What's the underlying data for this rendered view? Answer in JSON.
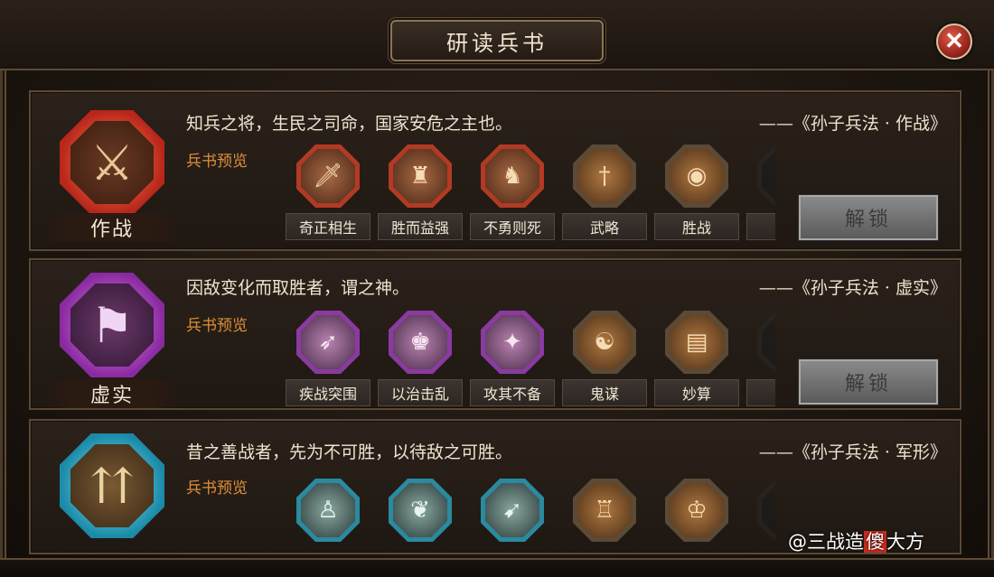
{
  "window": {
    "title": "研读兵书",
    "close_glyph": "✕"
  },
  "books": [
    {
      "name": "作战",
      "quote": "知兵之将，生民之司命，国家安危之主也。",
      "source": "——《孙子兵法 · 作战》",
      "preview_label": "兵书预览",
      "emblem_icon": "crossed-swords-icon",
      "skills": [
        {
          "name": "奇正相生",
          "icon": "sword-strike-icon"
        },
        {
          "name": "胜而益强",
          "icon": "warrior-icon"
        },
        {
          "name": "不勇则死",
          "icon": "charging-soldier-icon"
        },
        {
          "name": "武略",
          "icon": "dagger-icon"
        },
        {
          "name": "胜战",
          "icon": "war-drum-icon"
        },
        {
          "name": "",
          "icon": "partial-icon"
        }
      ],
      "unlock_label": "解锁"
    },
    {
      "name": "虚实",
      "quote": "因敌变化而取胜者，谓之神。",
      "source": "——《孙子兵法 · 虚实》",
      "preview_label": "兵书预览",
      "emblem_icon": "war-banner-icon",
      "skills": [
        {
          "name": "疾战突围",
          "icon": "arrows-icon"
        },
        {
          "name": "以治击乱",
          "icon": "commander-icon"
        },
        {
          "name": "攻其不备",
          "icon": "ambush-icon"
        },
        {
          "name": "鬼谋",
          "icon": "strategist-icon"
        },
        {
          "name": "妙算",
          "icon": "scroll-icon"
        },
        {
          "name": "",
          "icon": "partial-icon"
        }
      ],
      "unlock_label": "解锁"
    },
    {
      "name": "",
      "quote": "昔之善战者，先为不可胜，以待敌之可胜。",
      "source": "——《孙子兵法 · 军形》",
      "preview_label": "兵书预览",
      "emblem_icon": "rising-arrows-icon",
      "skills": [
        {
          "name": "",
          "icon": "troops-icon"
        },
        {
          "name": "",
          "icon": "plant-icon"
        },
        {
          "name": "",
          "icon": "archer-icon"
        },
        {
          "name": "",
          "icon": "fortress-icon"
        },
        {
          "name": "",
          "icon": "general-icon"
        },
        {
          "name": "",
          "icon": "partial-icon"
        }
      ],
      "unlock_label": ""
    }
  ],
  "watermark": {
    "prefix": "@三战造",
    "highlight": "傻",
    "suffix": "大方"
  }
}
